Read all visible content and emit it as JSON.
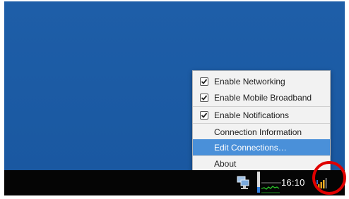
{
  "menu": {
    "items": [
      {
        "label": "Enable Networking",
        "checked": true,
        "type": "check"
      },
      {
        "label": "Enable Mobile Broadband",
        "checked": true,
        "type": "check"
      },
      {
        "label": "Enable Notifications",
        "checked": true,
        "type": "check"
      },
      {
        "label": "Connection Information",
        "type": "action"
      },
      {
        "label": "Edit Connections…",
        "type": "action",
        "highlighted": true
      },
      {
        "label": "About",
        "type": "action"
      }
    ]
  },
  "panel": {
    "clock": "16:10",
    "icons": [
      "network-computers-icon",
      "system-monitor-graph-icon",
      "network-manager-signal-icon"
    ]
  },
  "colors": {
    "desktop": "#1b5aa3",
    "highlight": "#4a90d9",
    "annotation": "#e00000"
  }
}
